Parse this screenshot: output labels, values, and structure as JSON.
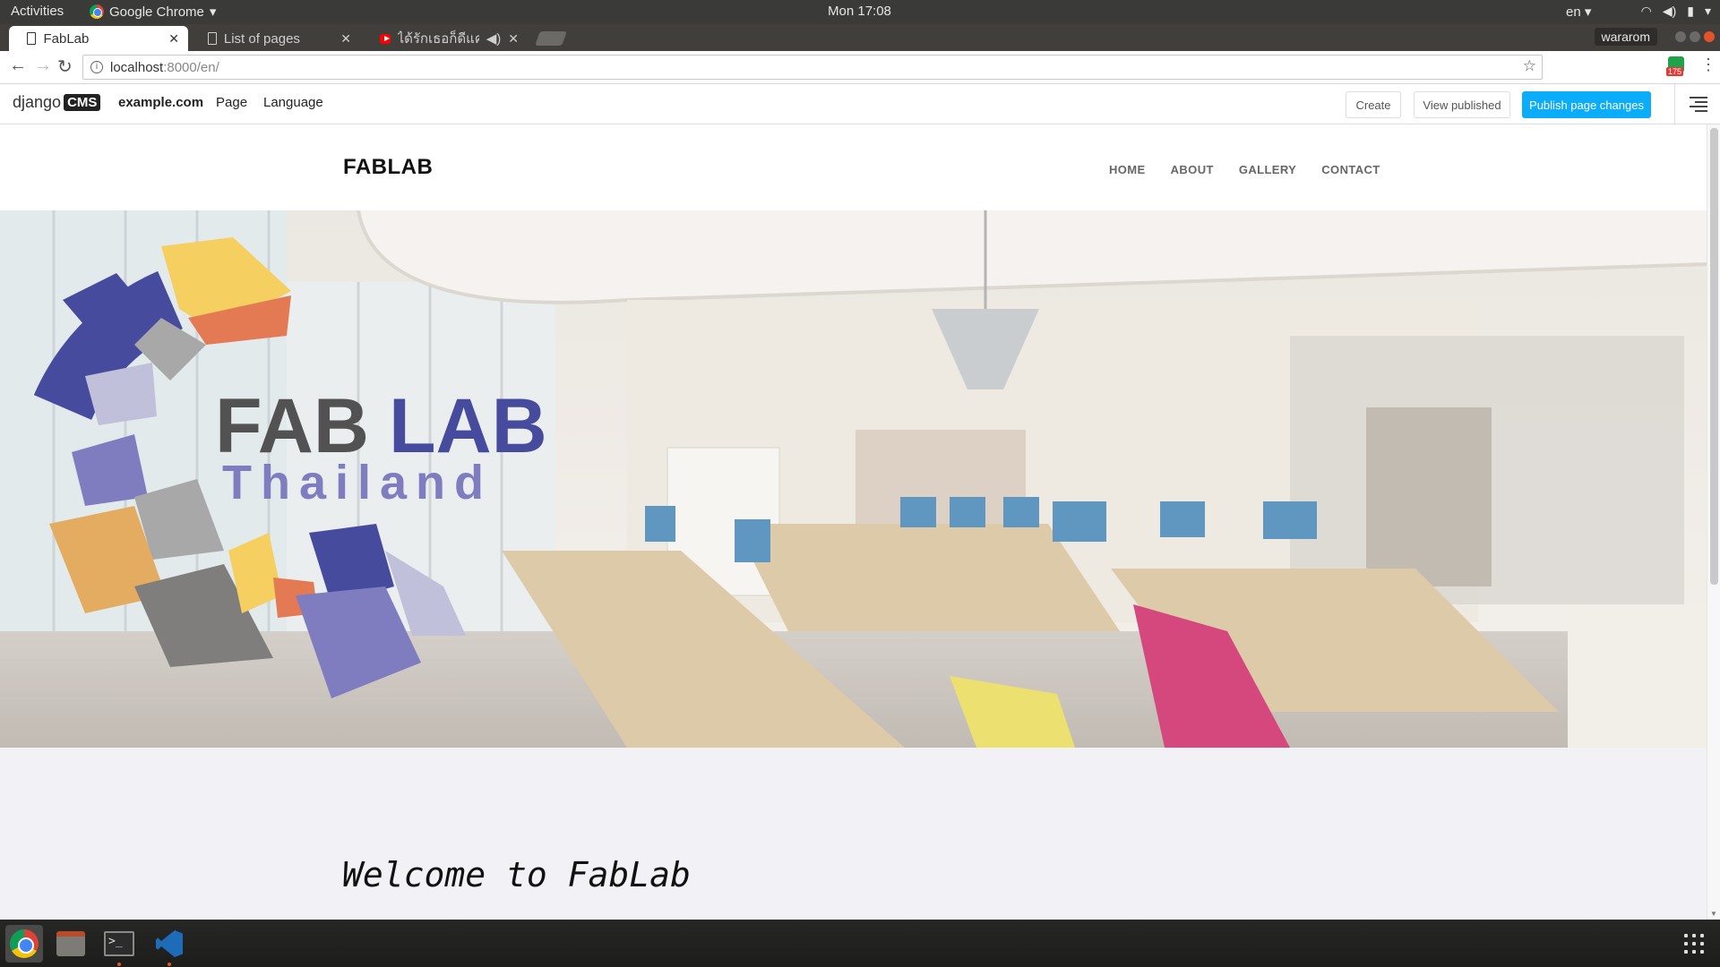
{
  "os_topbar": {
    "activities": "Activities",
    "app_name": "Google Chrome",
    "clock": "Mon 17:08",
    "language": "en"
  },
  "browser": {
    "tabs": [
      {
        "title": "FabLab",
        "icon": "page-icon",
        "active": true
      },
      {
        "title": "List of pages",
        "icon": "page-icon",
        "active": false
      },
      {
        "title": "ได้รักเธอก็ดีแค่ไหน",
        "icon": "youtube-icon",
        "active": false
      }
    ],
    "profile_name": "wararom",
    "url_host": "localhost",
    "url_rest": ":8000/en/",
    "extension_badge": "175"
  },
  "cms_toolbar": {
    "logo_text": "django",
    "logo_badge": "CMS",
    "site": "example.com",
    "page_menu": "Page",
    "language_menu": "Language",
    "create": "Create",
    "view_published": "View published",
    "publish": "Publish page changes",
    "publish_color": "#0bacfa"
  },
  "site": {
    "brand": "FABLAB",
    "nav": [
      "HOME",
      "ABOUT",
      "GALLERY",
      "CONTACT"
    ],
    "hero": {
      "logo_line1_a": "FAB",
      "logo_line1_b": "LAB",
      "logo_line2": "Thailand"
    },
    "welcome": "Welcome to FabLab"
  }
}
